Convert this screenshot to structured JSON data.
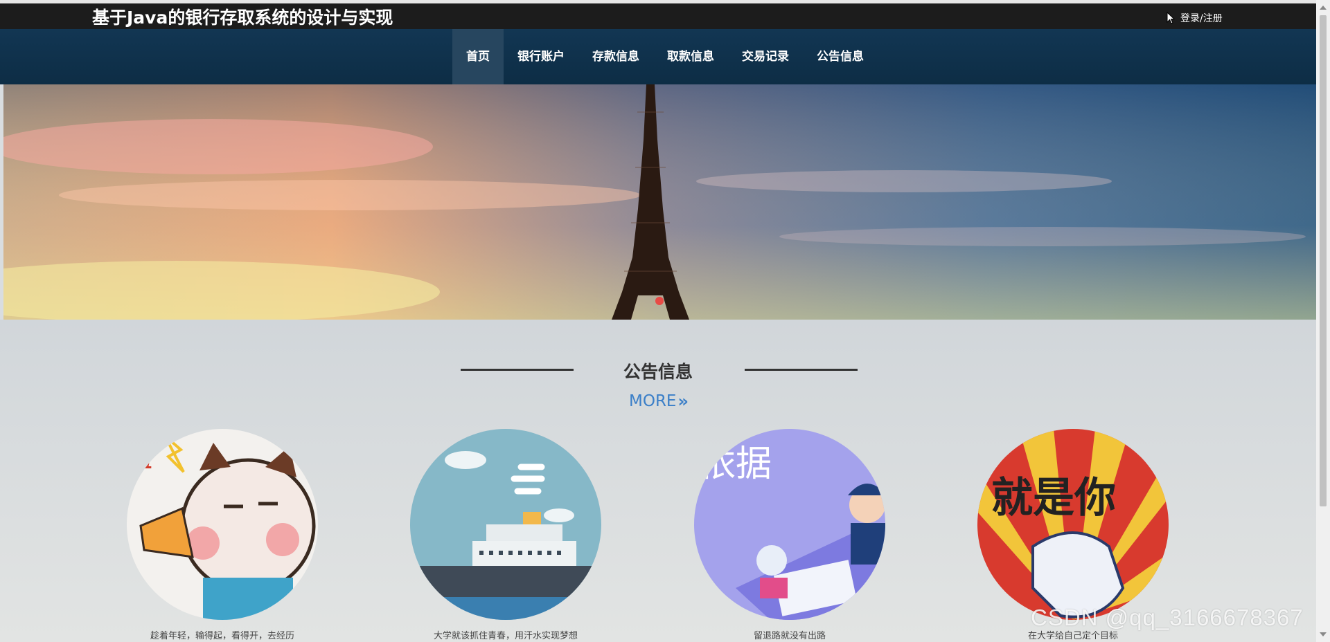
{
  "header": {
    "site_title": "基于Java的银行存取系统的设计与实现",
    "login_label": "登录/注册"
  },
  "nav": {
    "items": [
      {
        "label": "首页",
        "active": true
      },
      {
        "label": "银行账户"
      },
      {
        "label": "存款信息"
      },
      {
        "label": "取款信息"
      },
      {
        "label": "交易记录"
      },
      {
        "label": "公告信息"
      }
    ]
  },
  "section": {
    "title": "公告信息",
    "more_label": "MORE",
    "cards": [
      {
        "caption": "趁着年轻，输得起，看得开，去经历",
        "image_text": "啦"
      },
      {
        "caption": "大学就该抓住青春，用汗水实现梦想"
      },
      {
        "caption": "留退路就没有出路",
        "image_text": "依据"
      },
      {
        "caption": "在大学给自己定个目标",
        "image_text": "就是你"
      }
    ]
  },
  "watermark": "CSDN @qq_3166678367",
  "colors": {
    "topbar": "#1c1c1c",
    "navbar": "#123653",
    "nav_active": "#27465f",
    "more_link": "#3b7fc8",
    "banner_dot": "#e84a45"
  }
}
